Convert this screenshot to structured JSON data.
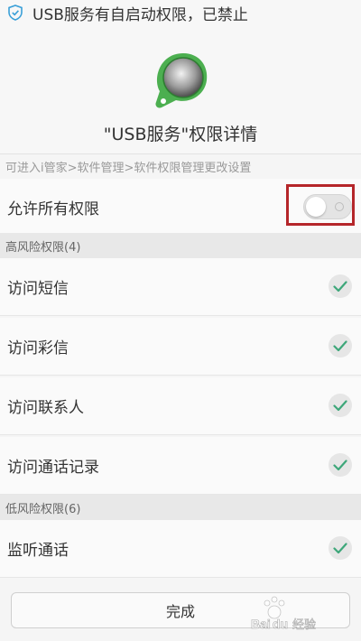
{
  "notification": {
    "text": "USB服务有自启动权限，已禁止",
    "icon": "shield-check-icon"
  },
  "header": {
    "app_icon": "usb-service-app-icon",
    "title": "\"USB服务\"权限详情"
  },
  "path_hint": "可进入i管家>软件管理>软件权限管理更改设置",
  "allow_all": {
    "label": "允许所有权限",
    "toggle_state": "off"
  },
  "high_risk": {
    "header": "高风险权限(4)",
    "items": [
      {
        "label": "访问短信",
        "checked": true
      },
      {
        "label": "访问彩信",
        "checked": true
      },
      {
        "label": "访问联系人",
        "checked": true
      },
      {
        "label": "访问通话记录",
        "checked": true
      }
    ]
  },
  "low_risk": {
    "header": "低风险权限(6)",
    "items": [
      {
        "label": "监听通话",
        "checked": true
      }
    ]
  },
  "footer": {
    "done_label": "完成"
  },
  "watermark": {
    "text": "Baidu经验"
  },
  "colors": {
    "check_green": "#3ea77a",
    "highlight_red": "#b5262a",
    "icon_green": "#4caf50"
  }
}
